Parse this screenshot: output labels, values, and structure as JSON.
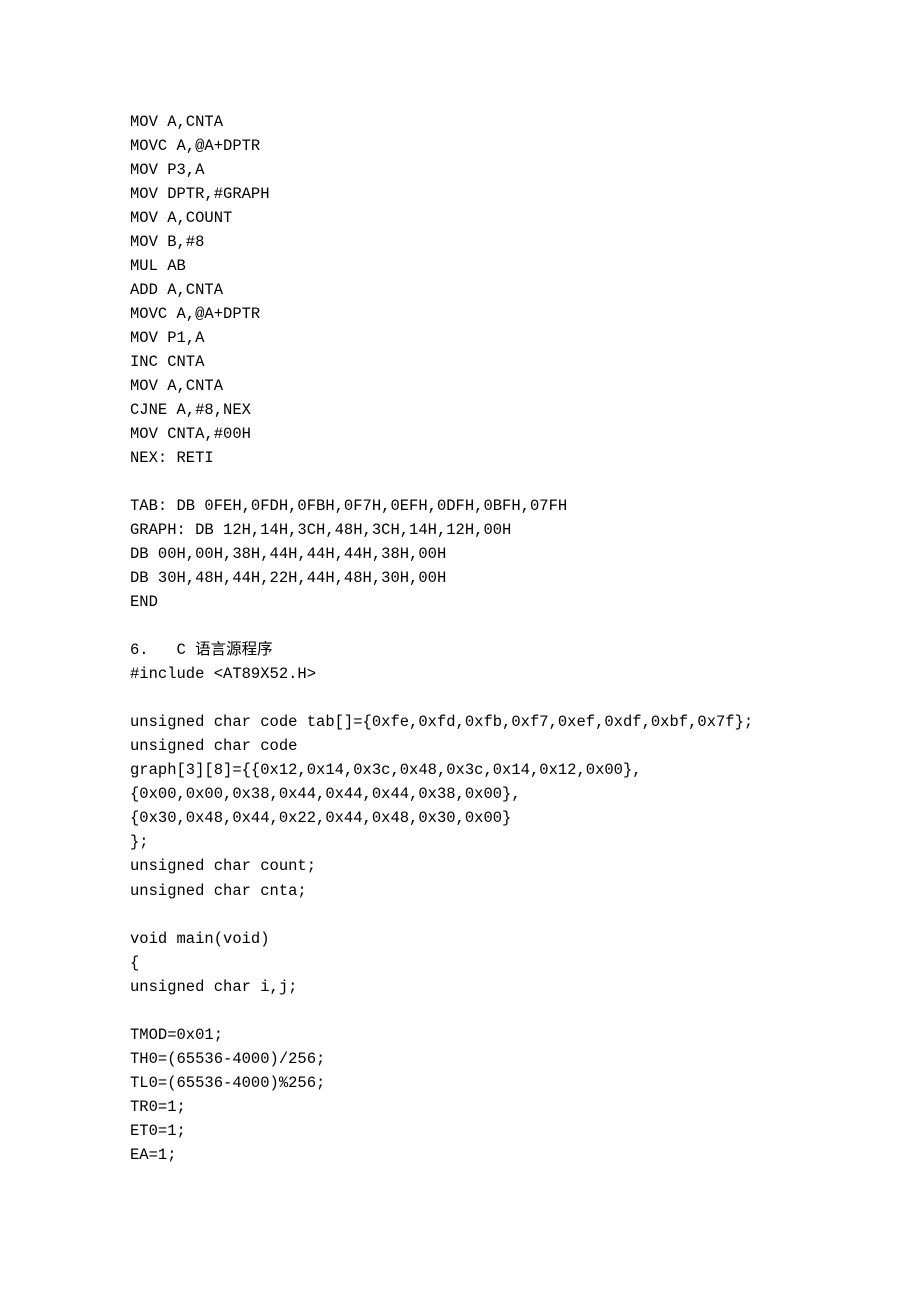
{
  "lines": [
    "MOV A,CNTA",
    "MOVC A,@A+DPTR",
    "MOV P3,A",
    "MOV DPTR,#GRAPH",
    "MOV A,COUNT",
    "MOV B,#8",
    "MUL AB",
    "ADD A,CNTA",
    "MOVC A,@A+DPTR",
    "MOV P1,A",
    "INC CNTA",
    "MOV A,CNTA",
    "CJNE A,#8,NEX",
    "MOV CNTA,#00H",
    "NEX: RETI",
    "",
    "TAB: DB 0FEH,0FDH,0FBH,0F7H,0EFH,0DFH,0BFH,07FH",
    "GRAPH: DB 12H,14H,3CH,48H,3CH,14H,12H,00H",
    "DB 00H,00H,38H,44H,44H,44H,38H,00H",
    "DB 30H,48H,44H,22H,44H,48H,30H,00H",
    "END",
    "",
    "6.   C 语言源程序",
    "#include <AT89X52.H>",
    "",
    "unsigned char code tab[]={0xfe,0xfd,0xfb,0xf7,0xef,0xdf,0xbf,0x7f};",
    "unsigned char code",
    "graph[3][8]={{0x12,0x14,0x3c,0x48,0x3c,0x14,0x12,0x00},",
    "{0x00,0x00,0x38,0x44,0x44,0x44,0x38,0x00},",
    "{0x30,0x48,0x44,0x22,0x44,0x48,0x30,0x00}",
    "};",
    "unsigned char count;",
    "unsigned char cnta;",
    "",
    "void main(void)",
    "{",
    "unsigned char i,j;",
    "",
    "TMOD=0x01;",
    "TH0=(65536-4000)/256;",
    "TL0=(65536-4000)%256;",
    "TR0=1;",
    "ET0=1;",
    "EA=1;"
  ]
}
